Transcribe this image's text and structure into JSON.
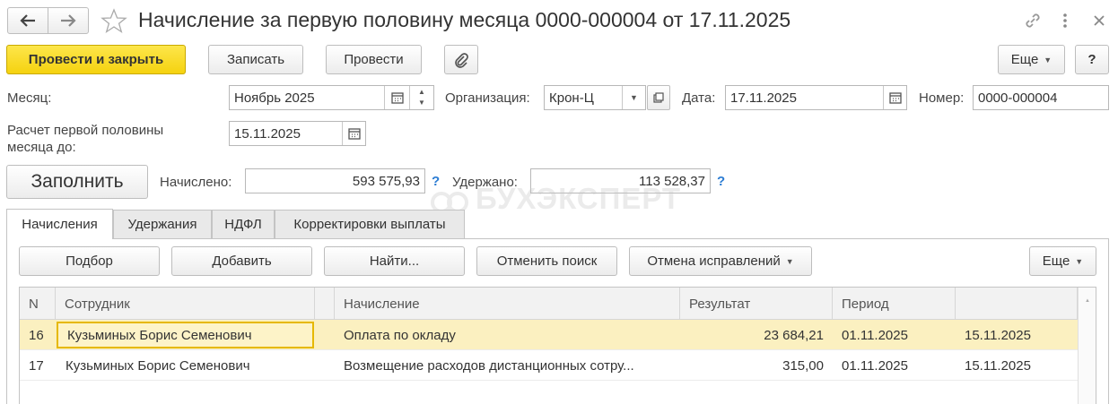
{
  "window": {
    "title": "Начисление за первую половину месяца 0000-000004 от 17.11.2025"
  },
  "toolbar": {
    "post_close_label": "Провести и закрыть",
    "save_label": "Записать",
    "post_label": "Провести",
    "more_label": "Еще",
    "help_label": "?"
  },
  "header": {
    "month_label": "Месяц:",
    "month_value": "Ноябрь 2025",
    "org_label": "Организация:",
    "org_value": "Крон-Ц",
    "date_label": "Дата:",
    "date_value": "17.11.2025",
    "number_label": "Номер:",
    "number_value": "0000-000004",
    "calc_label_line1": "Расчет первой половины",
    "calc_label_line2": "месяца до:",
    "calc_value": "15.11.2025"
  },
  "summary": {
    "fill_label": "Заполнить",
    "accrued_label": "Начислено:",
    "accrued_value": "593 575,93",
    "withheld_label": "Удержано:",
    "withheld_value": "113 528,37",
    "help": "?"
  },
  "watermark": "БУХЭКСПЕРТ",
  "tabs": [
    {
      "label": "Начисления"
    },
    {
      "label": "Удержания"
    },
    {
      "label": "НДФЛ"
    },
    {
      "label": "Корректировки выплаты"
    }
  ],
  "table_toolbar": {
    "select_label": "Подбор",
    "add_label": "Добавить",
    "find_label": "Найти...",
    "cancel_search_label": "Отменить поиск",
    "cancel_corrections_label": "Отмена исправлений",
    "more_label": "Еще"
  },
  "table": {
    "columns": [
      "N",
      "Сотрудник",
      "Начисление",
      "Результат",
      "Период"
    ],
    "rows": [
      {
        "n": "16",
        "employee": "Кузьминых Борис Семенович",
        "accrual": "Оплата по окладу",
        "result": "23 684,21",
        "from": "01.11.2025",
        "to": "15.11.2025"
      },
      {
        "n": "17",
        "employee": "Кузьминых Борис Семенович",
        "accrual": "Возмещение расходов дистанционных сотру...",
        "result": "315,00",
        "from": "01.11.2025",
        "to": "15.11.2025"
      }
    ]
  },
  "colors": {
    "primary": "#f5d20f",
    "selected_row": "#fbf0c0",
    "selected_cell_border": "#e6b800",
    "help": "#2b7cd3"
  }
}
